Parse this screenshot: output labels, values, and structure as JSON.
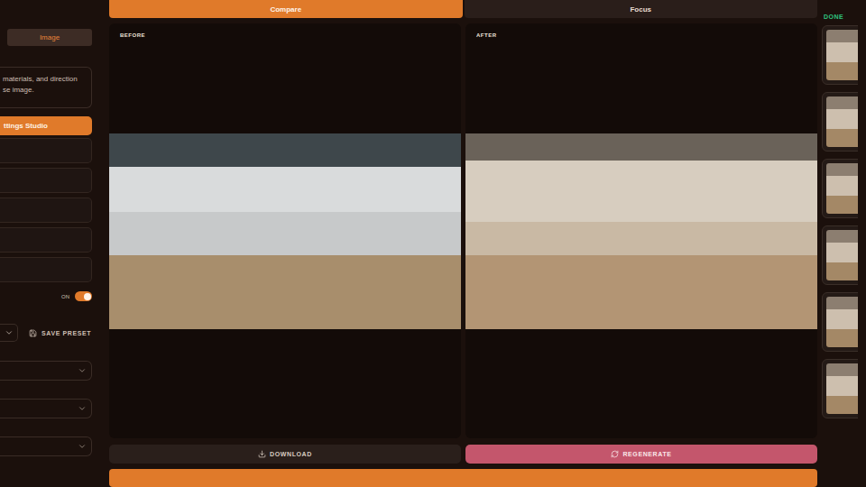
{
  "sidebar": {
    "mode_tabs": [
      {
        "label": "Image",
        "selected": true
      }
    ],
    "prompt_hint": [
      "materials, and direction",
      "se image."
    ],
    "section": "ttings Studio",
    "toggle": {
      "label": "ON",
      "on": true
    },
    "save_preset": "SAVE PRESET"
  },
  "view_tabs": [
    {
      "label": "Compare",
      "selected": true
    },
    {
      "label": "Focus",
      "selected": false
    }
  ],
  "panels": [
    {
      "label": "BEFORE",
      "kind": "before"
    },
    {
      "label": "AFTER",
      "kind": "after"
    }
  ],
  "actions": [
    {
      "label": "DOWNLOAD",
      "kind": "secondary"
    },
    {
      "label": "REGENERATE",
      "kind": "primary"
    }
  ],
  "results": {
    "status": "DONE"
  }
}
